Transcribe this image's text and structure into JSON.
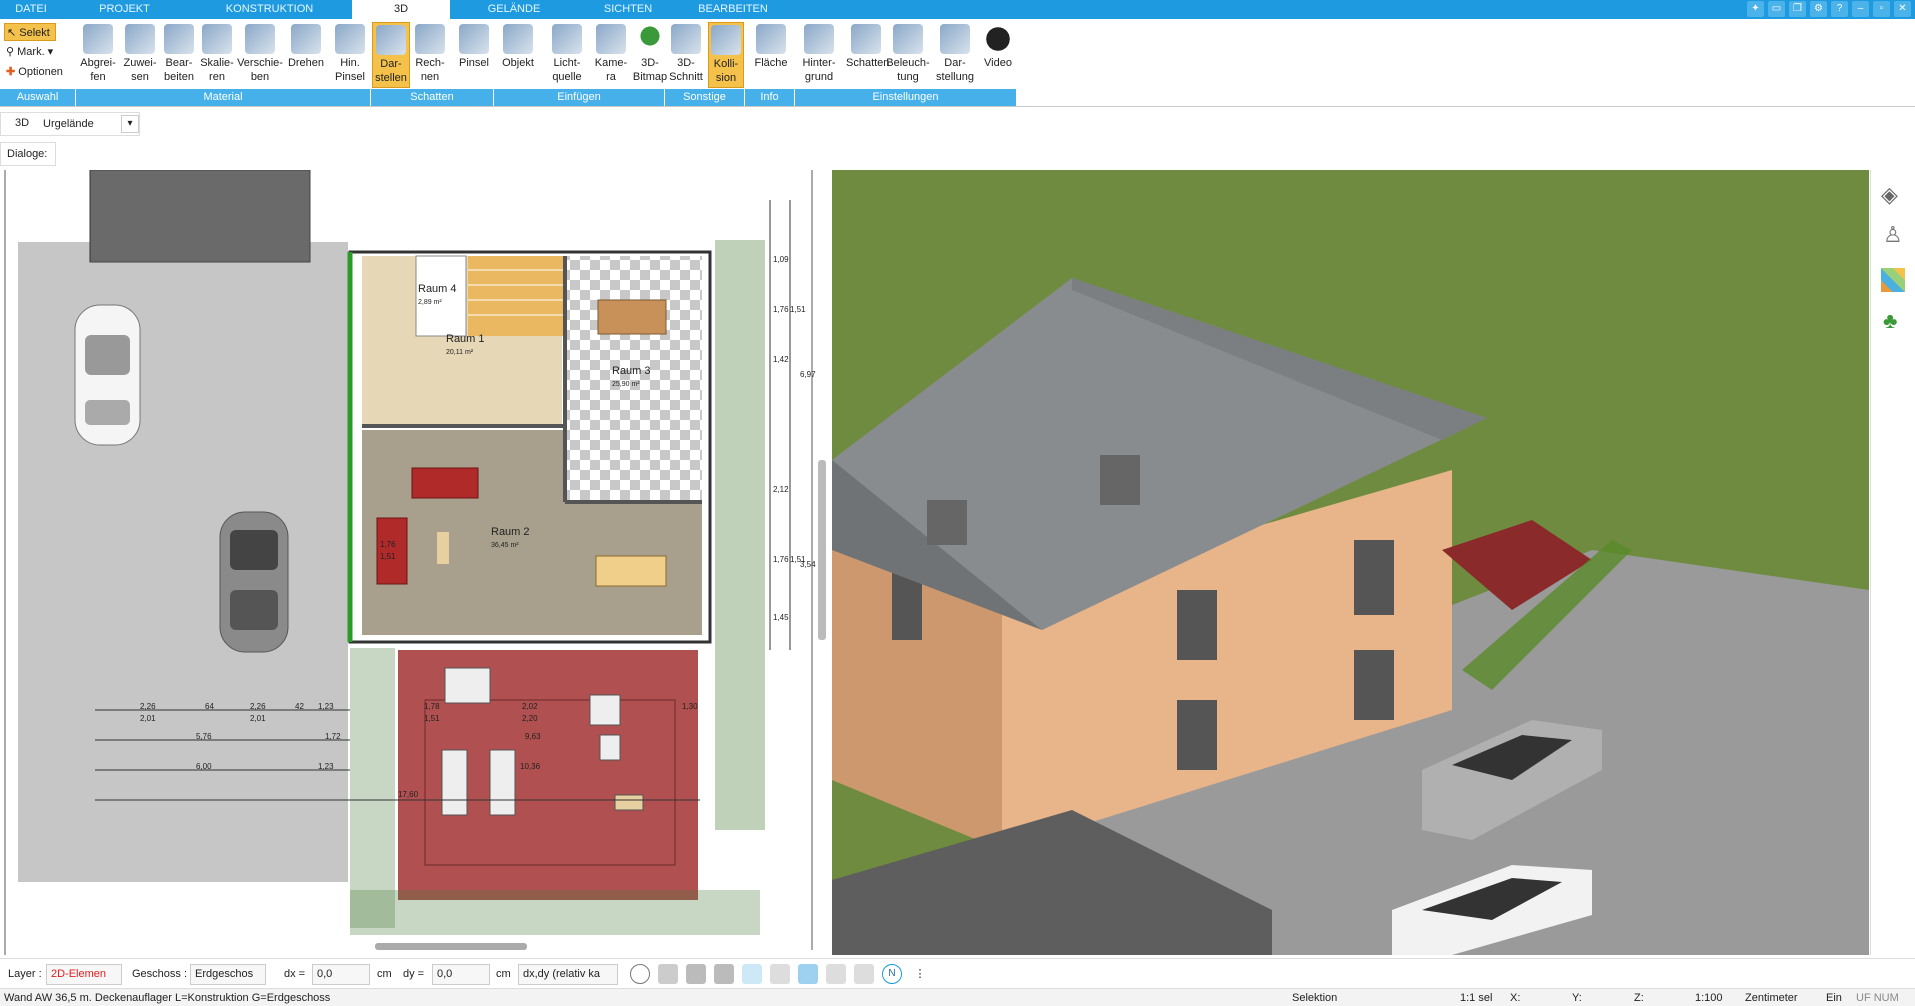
{
  "tabs": [
    {
      "label": "DATEI",
      "w": 62
    },
    {
      "label": "PROJEKT",
      "w": 125
    },
    {
      "label": "KONSTRUKTION",
      "w": 165
    },
    {
      "label": "3D",
      "w": 98
    },
    {
      "label": "GELÄNDE",
      "w": 128
    },
    {
      "label": "SICHTEN",
      "w": 100
    },
    {
      "label": "BEARBEITEN",
      "w": 110
    }
  ],
  "auswahl": {
    "selekt": "Selekt",
    "mark": "Mark.",
    "optionen": "Optionen"
  },
  "ribbon_buttons": [
    {
      "label": "Abgrei-\nfen"
    },
    {
      "label": "Zuwei-\nsen"
    },
    {
      "label": "Bear-\nbeiten"
    },
    {
      "label": "Skalie-\nren"
    },
    {
      "label": "Verschie-\nben"
    },
    {
      "label": "Drehen"
    },
    {
      "label": "Hin.\nPinsel"
    },
    {
      "label": "Dar-\nstellen"
    },
    {
      "label": "Rech-\nnen"
    },
    {
      "label": "Pinsel"
    },
    {
      "label": "Objekt"
    },
    {
      "label": "Licht-\nquelle"
    },
    {
      "label": "Kame-\nra"
    },
    {
      "label": "3D-\nBitmap"
    },
    {
      "label": "3D-\nSchnitt"
    },
    {
      "label": "Kolli-\nsion"
    },
    {
      "label": "Fläche"
    },
    {
      "label": "Hinter-\ngrund"
    },
    {
      "label": "Schatten"
    },
    {
      "label": "Beleuch-\ntung"
    },
    {
      "label": "Dar-\nstellung"
    },
    {
      "label": "Video"
    }
  ],
  "groups": [
    "Auswahl",
    "Material",
    "Schatten",
    "Einfügen",
    "Sonstige",
    "Info",
    "Einstellungen"
  ],
  "row2": {
    "mode": "3D",
    "terrain": "Urgelände"
  },
  "row3": {
    "label": "Dialoge:"
  },
  "plan": {
    "rooms": [
      {
        "name": "Raum 4",
        "area": "2,89 m²"
      },
      {
        "name": "Raum 1",
        "area": "20,11 m²"
      },
      {
        "name": "Raum 3",
        "area": "25,90 m²"
      },
      {
        "name": "Raum 2",
        "area": "36,45 m²"
      }
    ],
    "dims": [
      "2,26",
      "2,01",
      "64",
      "2,26",
      "2,01",
      "42",
      "1,23",
      "5,76",
      "1,72",
      "6,00",
      "1,23",
      "1,78",
      "1,51",
      "2,02",
      "2,20",
      "9,63",
      "10,36",
      "17,60",
      "1,30",
      "1,76",
      "1,51",
      "1,09",
      "1,42",
      "1,76",
      "1,51",
      "2,12",
      "1,76",
      "1,51",
      "1,45",
      "6,97",
      "3,54"
    ]
  },
  "bottom": {
    "layer_label": "Layer :",
    "layer_value": "2D-Elemen",
    "geschoss_label": "Geschoss :",
    "geschoss_value": "Erdgeschos",
    "dx_label": "dx =",
    "dx_value": "0,0",
    "dx_unit": "cm",
    "dy_label": "dy =",
    "dy_value": "0,0",
    "dy_unit": "cm",
    "rel_value": "dx,dy (relativ ka"
  },
  "status": {
    "text": "Wand AW 36,5 m. Deckenauflager L=Konstruktion G=Erdgeschoss",
    "selektion": "Selektion",
    "sel": "1:1 sel",
    "x": "X:",
    "y": "Y:",
    "z": "Z:",
    "scale": "1:100",
    "unit": "Zentimeter",
    "ein": "Ein",
    "flags": "UF  NUM  RF"
  },
  "colors": {
    "accent": "#1e9be0",
    "group": "#45b0ea",
    "active": "#f4c14a",
    "layer_red": "#e02020"
  }
}
